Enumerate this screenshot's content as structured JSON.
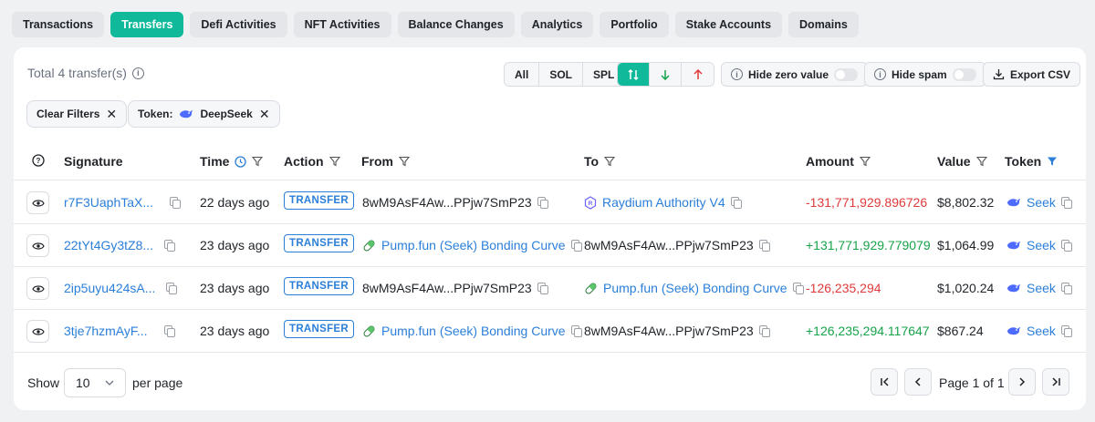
{
  "tabs": [
    "Transactions",
    "Transfers",
    "Defi Activities",
    "NFT Activities",
    "Balance Changes",
    "Analytics",
    "Portfolio",
    "Stake Accounts",
    "Domains"
  ],
  "total_label": "Total 4 transfer(s)",
  "filters": {
    "all": "All",
    "sol": "SOL",
    "spl": "SPL",
    "hide_zero": "Hide zero value",
    "hide_spam": "Hide spam",
    "export": "Export CSV",
    "clear": "Clear Filters",
    "token_prefix": "Token:",
    "token_name": "DeepSeek"
  },
  "columns": {
    "signature": "Signature",
    "time": "Time",
    "action": "Action",
    "from": "From",
    "to": "To",
    "amount": "Amount",
    "value": "Value",
    "token": "Token"
  },
  "rows": [
    {
      "signature": "r7F3UaphTaX...",
      "time": "22 days ago",
      "action": "TRANSFER",
      "from": "8wM9AsF4Aw...PPjw7SmP23",
      "to": "Raydium Authority V4",
      "amount": "-131,771,929.896726",
      "value": "$8,802.32",
      "token": "Seek"
    },
    {
      "signature": "22tYt4Gy3tZ8...",
      "time": "23 days ago",
      "action": "TRANSFER",
      "from": "Pump.fun (Seek) Bonding Curve",
      "to": "8wM9AsF4Aw...PPjw7SmP23",
      "amount": "+131,771,929.779079",
      "value": "$1,064.99",
      "token": "Seek"
    },
    {
      "signature": "2ip5uyu424sA...",
      "time": "23 days ago",
      "action": "TRANSFER",
      "from": "8wM9AsF4Aw...PPjw7SmP23",
      "to": "Pump.fun (Seek) Bonding Curve",
      "amount": "-126,235,294",
      "value": "$1,020.24",
      "token": "Seek"
    },
    {
      "signature": "3tje7hzmAyF...",
      "time": "23 days ago",
      "action": "TRANSFER",
      "from": "Pump.fun (Seek) Bonding Curve",
      "to": "8wM9AsF4Aw...PPjw7SmP23",
      "amount": "+126,235,294.117647",
      "value": "$867.24",
      "token": "Seek"
    }
  ],
  "footer": {
    "show": "Show",
    "per_page_value": "10",
    "per_page": "per page",
    "page_label": "Page 1 of 1"
  },
  "colors": {
    "accent": "#10b99a",
    "link": "#2b7fd9",
    "negative": "#e03a3a",
    "positive": "#17a34a"
  }
}
